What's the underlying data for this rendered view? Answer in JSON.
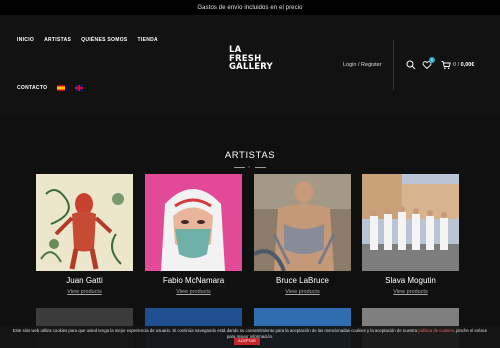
{
  "topbar": {
    "text": "Gastos de envío incluidos en el precio"
  },
  "nav": {
    "row1": [
      {
        "label": "INICIO"
      },
      {
        "label": "ARTISTAS"
      },
      {
        "label": "QUIÉNES SOMOS"
      },
      {
        "label": "TIENDA"
      }
    ],
    "contact": "CONTACTO"
  },
  "logo": {
    "line1": "LA",
    "line2": "FRESH",
    "line3": "GALLERY"
  },
  "header_actions": {
    "login": "Login / Register",
    "wishlist_count": "0",
    "cart_count": "0 /",
    "cart_total": "0,00€"
  },
  "section": {
    "title": "ARTISTAS",
    "divider_glyph": "×"
  },
  "artists": [
    {
      "name": "Juan Gatti",
      "link": "View products"
    },
    {
      "name": "Fabio McNamara",
      "link": "View products"
    },
    {
      "name": "Bruce LaBruce",
      "link": "View products"
    },
    {
      "name": "Slava Mogutin",
      "link": "View products"
    }
  ],
  "cookie": {
    "text": "Este sitio web utiliza cookies para que usted tenga la mejor experiencia de usuario. Si continúa navegando está dando su consentimiento para la aceptación de las mencionadas cookies y la aceptación de nuestra",
    "link": "política de cookies",
    "text_end": ", pinche el enlace para mayor información.",
    "accept": "ACEPTAR"
  }
}
